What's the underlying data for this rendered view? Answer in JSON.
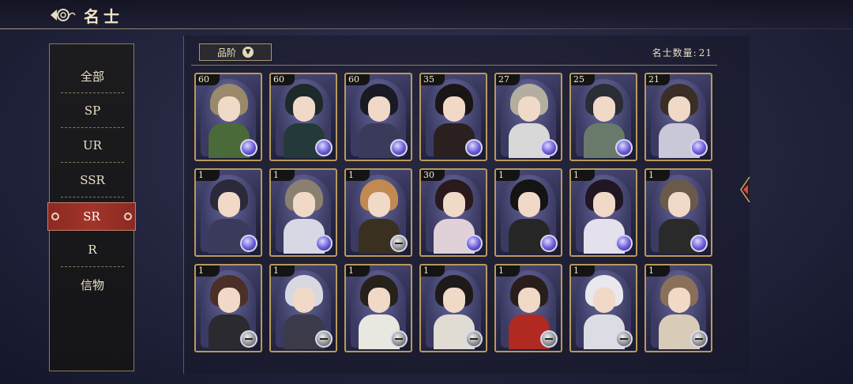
{
  "header": {
    "title": "名士",
    "back_icon": "cloud-ornament-back-icon"
  },
  "sidebar": {
    "items": [
      {
        "label": "全部",
        "active": false
      },
      {
        "label": "SP",
        "active": false
      },
      {
        "label": "UR",
        "active": false
      },
      {
        "label": "SSR",
        "active": false
      },
      {
        "label": "SR",
        "active": true
      },
      {
        "label": "R",
        "active": false
      },
      {
        "label": "信物",
        "active": false
      }
    ]
  },
  "filter": {
    "label": "品阶",
    "icon": "chevron-down-icon"
  },
  "count": {
    "label": "名士数量:",
    "value": "21"
  },
  "colors": {
    "accent_red": "#a3342a",
    "gold_border": "#b99a5c",
    "panel_bg": "#1c1c1f"
  },
  "cards": [
    {
      "level": "60",
      "hair": "#9a8a6a",
      "outfit": "#4a6a3a",
      "orb": "blue"
    },
    {
      "level": "60",
      "hair": "#1e2a2a",
      "outfit": "#243a3a",
      "orb": "blue"
    },
    {
      "level": "60",
      "hair": "#1a1a24",
      "outfit": "#3a3a5a",
      "orb": "blue"
    },
    {
      "level": "35",
      "hair": "#1a1616",
      "outfit": "#2a2020",
      "orb": "blue"
    },
    {
      "level": "27",
      "hair": "#b4aea0",
      "outfit": "#d8d8d8",
      "orb": "blue"
    },
    {
      "level": "25",
      "hair": "#2a2e34",
      "outfit": "#6a7a6a",
      "orb": "blue"
    },
    {
      "level": "21",
      "hair": "#3a2e26",
      "outfit": "#c8c8d8",
      "orb": "blue"
    },
    {
      "level": "1",
      "hair": "#2a2a3a",
      "outfit": "#3a3a5a",
      "orb": "blue"
    },
    {
      "level": "1",
      "hair": "#8a8070",
      "outfit": "#d8d8e4",
      "orb": "blue"
    },
    {
      "level": "1",
      "hair": "#c08a50",
      "outfit": "#3a3020",
      "orb": "grey"
    },
    {
      "level": "30",
      "hair": "#2a1a1e",
      "outfit": "#e0d0d8",
      "orb": "blue"
    },
    {
      "level": "1",
      "hair": "#141414",
      "outfit": "#262626",
      "orb": "blue"
    },
    {
      "level": "1",
      "hair": "#201624",
      "outfit": "#e4e0ec",
      "orb": "blue"
    },
    {
      "level": "1",
      "hair": "#6a5a4a",
      "outfit": "#2a2a2a",
      "orb": "blue"
    },
    {
      "level": "1",
      "hair": "#4a3026",
      "outfit": "#2a2a30",
      "orb": "grey"
    },
    {
      "level": "1",
      "hair": "#d8d8e0",
      "outfit": "#3a3a4a",
      "orb": "grey"
    },
    {
      "level": "1",
      "hair": "#26221a",
      "outfit": "#e8e8e0",
      "orb": "grey"
    },
    {
      "level": "1",
      "hair": "#1e1a1a",
      "outfit": "#e0dcd4",
      "orb": "grey"
    },
    {
      "level": "1",
      "hair": "#2a1e1a",
      "outfit": "#b02a22",
      "orb": "grey"
    },
    {
      "level": "1",
      "hair": "#e8e8ee",
      "outfit": "#dcdce4",
      "orb": "grey"
    },
    {
      "level": "1",
      "hair": "#8a7058",
      "outfit": "#d8ccb8",
      "orb": "grey"
    }
  ]
}
